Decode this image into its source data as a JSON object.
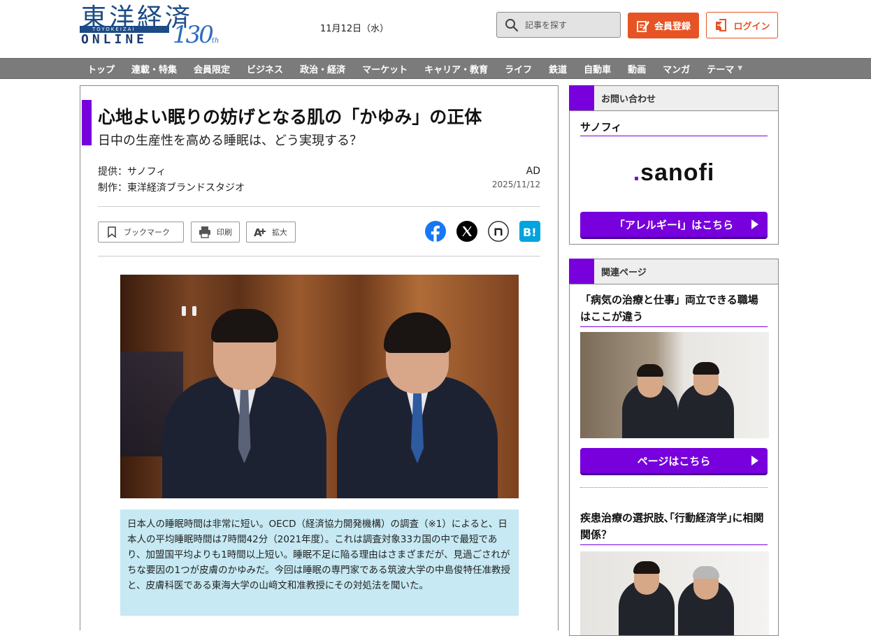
{
  "header": {
    "logo": {
      "kanji": "東洋経済",
      "band": "TOYOKEIZAI",
      "online": "ONLINE",
      "anniversary": "130",
      "anniversary_suffix": "th"
    },
    "date": "11月12日（水）",
    "search_placeholder": "記事を探す",
    "register_label": "会員登録",
    "login_label": "ログイン"
  },
  "nav": {
    "items": [
      "トップ",
      "連載・特集",
      "会員限定",
      "ビジネス",
      "政治・経済",
      "マーケット",
      "キャリア・教育",
      "ライフ",
      "鉄道",
      "自動車",
      "動画",
      "マンガ",
      "テーマ"
    ]
  },
  "article": {
    "title": "心地よい眠りの妨げとなる肌の「かゆみ」の正体",
    "subtitle": "日中の生産性を高める睡眠は、どう実現する？",
    "provider": "提供：サノフィ",
    "producer": "制作：東洋経済ブランドスタジオ",
    "ad_label": "AD",
    "published": "2025/11/12",
    "tools": {
      "bookmark": "ブックマーク",
      "print": "印刷",
      "zoom": "拡大"
    },
    "lead": "日本人の睡眠時間は非常に短い。OECD（経済協力開発機構）の調査（※1）によると、日本人の平均睡眠時間は7時間42分（2021年度）。これは調査対象33カ国の中で最短であり、加盟国平均よりも1時間以上短い。睡眠不足に陥る理由はさまざまだが、見過ごされがちな要因の1つが皮膚のかゆみだ。今回は睡眠の専門家である筑波大学の中島俊特任准教授と、皮膚科医である東海大学の山﨑文和准教授にその対処法を聞いた。"
  },
  "sidebar": {
    "contact": {
      "heading": "お問い合わせ",
      "sponsor": "サノフィ",
      "logo_text": "sanofi",
      "cta": "「アレルギーi」はこちら"
    },
    "related": {
      "heading": "関連ページ",
      "item1_title": "「病気の治療と仕事」両立できる職場はここが違う",
      "item1_cta": "ページはこちら",
      "item2_title": "疾患治療の選択肢､｢行動経済学｣に相関関係？"
    }
  },
  "colors": {
    "accent_purple": "#7700dd",
    "brand_orange": "#e65425",
    "nav_grey": "#7b7b7b",
    "lead_bg": "#c6e9f3",
    "logo_blue": "#1c4b86"
  }
}
